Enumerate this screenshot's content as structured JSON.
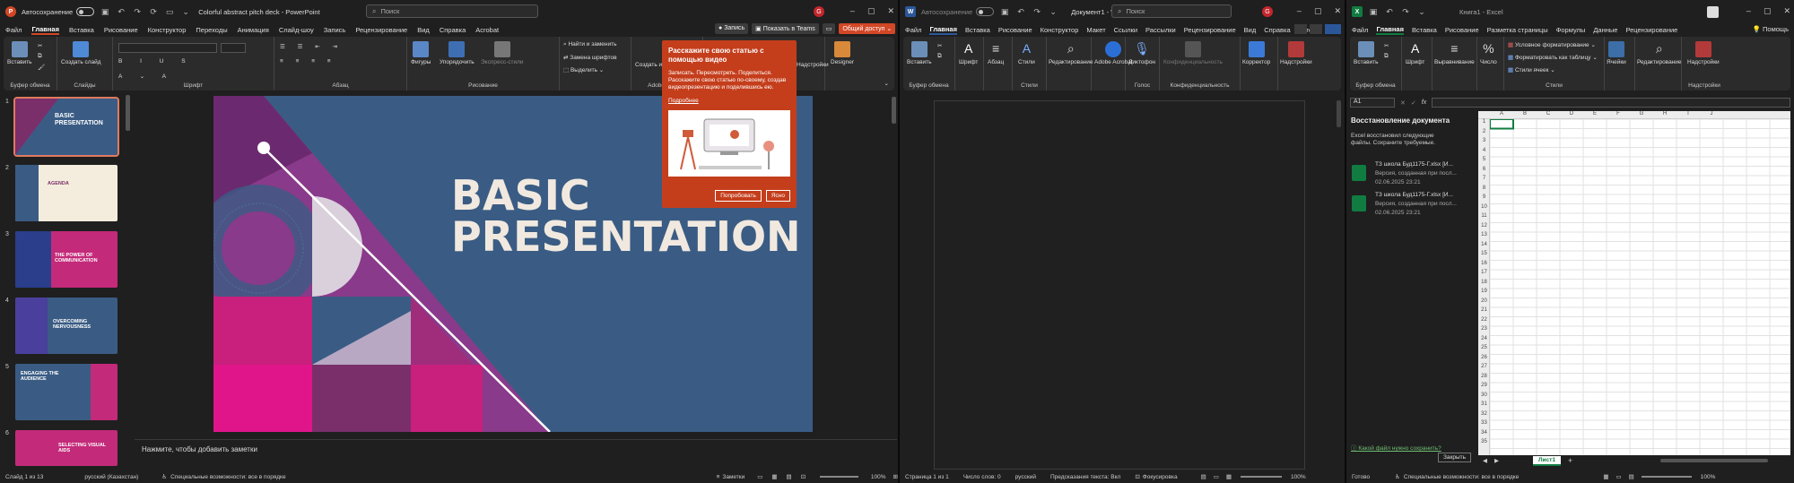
{
  "powerpoint": {
    "autosave_label": "Автосохранение",
    "title": "Colorful abstract pitch deck - PowerPoint",
    "search_placeholder": "Поиск",
    "avatar": "G",
    "menu": [
      "Файл",
      "Главная",
      "Вставка",
      "Рисование",
      "Конструктор",
      "Переходы",
      "Анимация",
      "Слайд-шоу",
      "Запись",
      "Рецензирование",
      "Вид",
      "Справка",
      "Acrobat"
    ],
    "record_button": "Запись",
    "teams_button": "Показать в Teams",
    "share_button": "Общий доступ",
    "ribbon": {
      "paste": "Вставить",
      "create_slide": "Создать слайд",
      "clipboard": "Буфер обмена",
      "slides": "Слайды",
      "font": "Шрифт",
      "paragraph": "Абзац",
      "shapes": "Фигуры",
      "arrange": "Упорядочить",
      "express_styles": "Экспресс-стили",
      "drawing": "Рисование",
      "find": "Найти и заменить",
      "replace_fonts": "Замена шрифтов",
      "select": "Выделить",
      "create_pdf": "Создать из PDF",
      "adobe": "Adobe Acrobat",
      "addins": "Надстройки",
      "designer": "Designer"
    },
    "callout": {
      "heading": "Расскажите свою статью с помощью видео",
      "body": "Записать. Пересмотреть. Поделиться. Расскажите свою статью по-своему, создав видеопрезентацию и поделившись ею.",
      "link": "Подробнее",
      "try": "Попробовать",
      "ok": "Ясно"
    },
    "slide": {
      "title_line1": "BASIC",
      "title_line2": "PRESENTATION"
    },
    "thumbnails": [
      {
        "num": "1",
        "title": "BASIC PRESENTATION"
      },
      {
        "num": "2",
        "title": "AGENDA"
      },
      {
        "num": "3",
        "title": "THE POWER OF COMMUNICATION"
      },
      {
        "num": "4",
        "title": "OVERCOMING NERVOUSNESS"
      },
      {
        "num": "5",
        "title": "ENGAGING THE AUDIENCE"
      },
      {
        "num": "6",
        "title": "SELECTING VISUAL AIDS"
      }
    ],
    "notes_placeholder": "Нажмите, чтобы добавить заметки",
    "status": {
      "slide": "Слайд 1 из 13",
      "language": "русский (Казахстан)",
      "accessibility": "Специальные возможности: все в порядке",
      "notes": "Заметки",
      "zoom": "100%"
    }
  },
  "word": {
    "autosave_label": "Автосохранение",
    "title": "Документ1 - W...",
    "search_placeholder": "Поиск",
    "avatar": "G",
    "menu": [
      "Файл",
      "Главная",
      "Вставка",
      "Рисование",
      "Конструктор",
      "Макет",
      "Ссылки",
      "Рассылки",
      "Рецензирование",
      "Вид",
      "Справка",
      "Acrobat"
    ],
    "ribbon": {
      "paste": "Вставить",
      "font": "Шрифт",
      "paragraph": "Абзац",
      "styles": "Стили",
      "editing": "Редактирование",
      "adobe": "Adobe Acrobat",
      "dictate": "Диктофон",
      "confidentiality": "Конфиденциальность",
      "corrector": "Корректор",
      "addins": "Надстройки",
      "clipboard": "Буфер обмена",
      "voice": "Голос"
    },
    "status": {
      "page": "Страница 1 из 1",
      "words": "Число слов: 0",
      "language": "русский",
      "predictions": "Предсказания текста: Вкл",
      "focus": "Фокусировка",
      "zoom": "100%"
    }
  },
  "excel": {
    "title": "Книга1 - Excel",
    "help": "Помощь",
    "menu": [
      "Файл",
      "Главная",
      "Вставка",
      "Рисование",
      "Разметка страницы",
      "Формулы",
      "Данные",
      "Рецензирование"
    ],
    "ribbon": {
      "paste": "Вставить",
      "font": "Шрифт",
      "alignment": "Выравнивание",
      "number": "Число",
      "conditional": "Условное форматирование",
      "format_table": "Форматировать как таблицу",
      "cell_styles": "Стили ячеек",
      "styles": "Стили",
      "cells": "Ячейки",
      "editing": "Редактирование",
      "addins": "Надстройки",
      "clipboard": "Буфер обмена"
    },
    "namebox": "A1",
    "fx": "fx",
    "recovery": {
      "title": "Восстановление документа",
      "desc": "Excel восстановил следующие файлы. Сохраните требуемые.",
      "files": [
        {
          "name": "ТЗ школа Буд1175-Г.xlsx [И...",
          "version": "Версия, созданная при посл...",
          "date": "02.06.2025 23:21"
        },
        {
          "name": "ТЗ школа Буд1175-Г.xlsx [И...",
          "version": "Версия, созданная при посл...",
          "date": "02.06.2025 23:21"
        }
      ],
      "question": "Какой файл нужно сохранить?",
      "close": "Закрыть"
    },
    "columns": [
      "A",
      "B",
      "C",
      "D",
      "E",
      "F",
      "G",
      "H",
      "I",
      "J"
    ],
    "rows": [
      "1",
      "2",
      "3",
      "4",
      "5",
      "6",
      "7",
      "8",
      "9",
      "10",
      "11",
      "12",
      "13",
      "14",
      "15",
      "16",
      "17",
      "18",
      "19",
      "20",
      "21",
      "22",
      "23",
      "24",
      "25",
      "26",
      "27",
      "28",
      "29",
      "30",
      "31",
      "32",
      "33",
      "34",
      "35"
    ],
    "sheet": "Лист1",
    "status": {
      "ready": "Готово",
      "accessibility": "Специальные возможности: все в порядке",
      "zoom": "100%"
    }
  }
}
